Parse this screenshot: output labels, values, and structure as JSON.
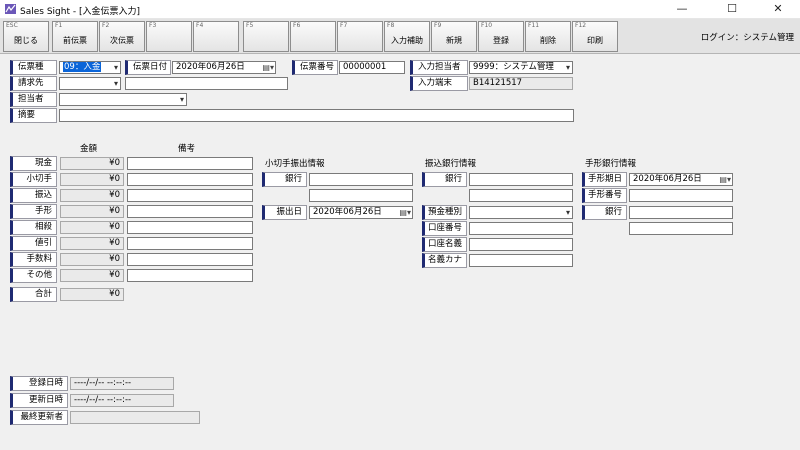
{
  "window": {
    "title": "Sales Sight - [入金伝票入力]",
    "minimize": "—",
    "maximize": "☐",
    "close": "✕"
  },
  "toolbar": {
    "keys": [
      {
        "key": "ESC",
        "label": "閉じる"
      },
      {
        "key": "F1",
        "label": "前伝票"
      },
      {
        "key": "F2",
        "label": "次伝票"
      },
      {
        "key": "F3",
        "label": ""
      },
      {
        "key": "F4",
        "label": ""
      },
      {
        "key": "F5",
        "label": ""
      },
      {
        "key": "F6",
        "label": ""
      },
      {
        "key": "F7",
        "label": ""
      },
      {
        "key": "F8",
        "label": "入力補助"
      },
      {
        "key": "F9",
        "label": "新規"
      },
      {
        "key": "F10",
        "label": "登録"
      },
      {
        "key": "F11",
        "label": "削除"
      },
      {
        "key": "F12",
        "label": "印刷"
      }
    ],
    "login": "ログイン：システム管理"
  },
  "header": {
    "slip_type_label": "伝票種",
    "slip_type_code": "09：入金",
    "slip_date_label": "伝票日付",
    "slip_date": "2020年06月26日",
    "slip_no_label": "伝票番号",
    "slip_no": "00000001",
    "input_user_label": "入力担当者",
    "input_user": "9999：システム管理",
    "terminal_label": "入力端末",
    "terminal": "B14121517",
    "billing_label": "請求先",
    "billing_code": "",
    "billing_name": "",
    "staff_label": "担当者",
    "staff": "",
    "summary_label": "摘要",
    "summary": ""
  },
  "amounts": {
    "col_amount": "金額",
    "col_note": "備考",
    "rows": [
      {
        "label": "現金",
        "value": "¥0",
        "note": ""
      },
      {
        "label": "小切手",
        "value": "¥0",
        "note": ""
      },
      {
        "label": "振込",
        "value": "¥0",
        "note": ""
      },
      {
        "label": "手形",
        "value": "¥0",
        "note": ""
      },
      {
        "label": "相殺",
        "value": "¥0",
        "note": ""
      },
      {
        "label": "値引",
        "value": "¥0",
        "note": ""
      },
      {
        "label": "手数料",
        "value": "¥0",
        "note": ""
      },
      {
        "label": "その他",
        "value": "¥0",
        "note": ""
      }
    ],
    "total_label": "合計",
    "total": "¥0"
  },
  "check": {
    "section": "小切手振出情報",
    "bank_label": "銀行",
    "bank": "",
    "bank2": "",
    "issue_date_label": "振出日",
    "issue_date": "2020年06月26日"
  },
  "transfer": {
    "section": "振込銀行情報",
    "bank_label": "銀行",
    "bank": "",
    "bank2": "",
    "deposit_type_label": "預金種別",
    "deposit_type": "",
    "account_no_label": "口座番号",
    "account_no": "",
    "account_name_label": "口座名義",
    "account_name": "",
    "kana_label": "名義カナ",
    "kana": ""
  },
  "bill": {
    "section": "手形銀行情報",
    "due_label": "手形期日",
    "due": "2020年06月26日",
    "no_label": "手形番号",
    "no": "",
    "bank_label": "銀行",
    "bank": "",
    "bank2": ""
  },
  "footer": {
    "created_label": "登録日時",
    "created": "----/--/-- --:--:--",
    "updated_label": "更新日時",
    "updated": "----/--/-- --:--:--",
    "last_user_label": "最終更新者",
    "last_user": ""
  },
  "icons": {
    "app": "app-logo-icon",
    "caret": "chevron-down-icon",
    "calendar": "calendar-icon"
  }
}
